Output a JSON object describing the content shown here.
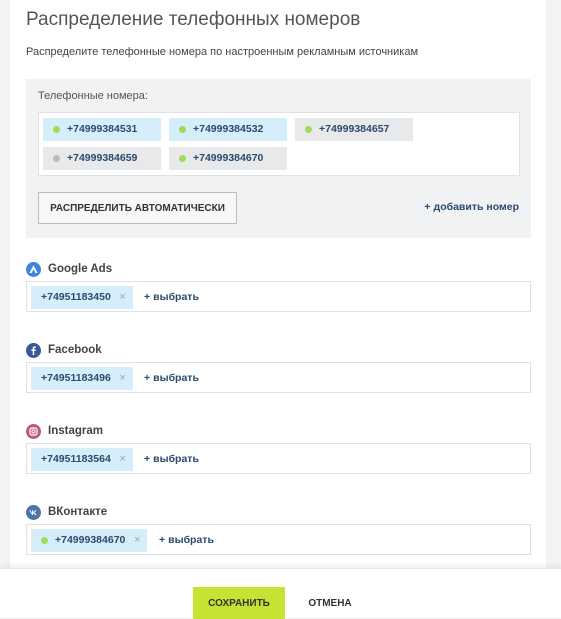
{
  "page": {
    "title": "Распределение телефонных номеров",
    "subtitle": "Распределите телефонные номера по настроенным рекламным источникам"
  },
  "phones": {
    "label": "Телефонные номера:",
    "items": [
      {
        "number": "+74999384531",
        "status": "green",
        "style": "blue"
      },
      {
        "number": "+74999384532",
        "status": "green",
        "style": "blue"
      },
      {
        "number": "+74999384657",
        "status": "green",
        "style": "grey"
      },
      {
        "number": "+74999384659",
        "status": "gray",
        "style": "grey"
      },
      {
        "number": "+74999384670",
        "status": "green",
        "style": "grey"
      }
    ],
    "auto_button": "РАСПРЕДЕЛИТЬ АВТОМАТИЧЕСКИ",
    "add_link": "добавить номер",
    "add_icon": "plus-icon"
  },
  "sources": [
    {
      "name": "Google Ads",
      "icon": "google-ads-icon",
      "color": "#3f86e0",
      "assigned": "+74951183450",
      "remove": "×",
      "select_label": "выбрать"
    },
    {
      "name": "Facebook",
      "icon": "facebook-icon",
      "color": "#3b5998",
      "assigned": "+74951183496",
      "remove": "×",
      "select_label": "выбрать"
    },
    {
      "name": "Instagram",
      "icon": "instagram-icon",
      "color": "#c0577f",
      "assigned": "+74951183564",
      "remove": "×",
      "select_label": "выбрать"
    },
    {
      "name": "ВКонтакте",
      "icon": "vk-icon",
      "color": "#4a76a8",
      "assigned": "+74999384670",
      "assigned_status": "green",
      "remove": "×",
      "select_label": "выбрать"
    }
  ],
  "footer": {
    "save": "СОХРАНИТЬ",
    "cancel": "ОТМЕНА"
  },
  "colors": {
    "accent": "#c6e232",
    "chip_blue": "#d6eefa",
    "chip_grey": "#e8e9eb",
    "link": "#2b4a6f",
    "status_green": "#9ddc5a",
    "status_gray": "#b8babd"
  }
}
